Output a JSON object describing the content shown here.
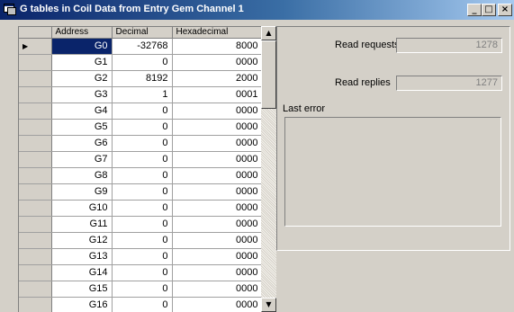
{
  "window": {
    "title": "G tables in Coil Data from Entry Gem Channel 1",
    "minimize": "_",
    "maximize": "□",
    "close": "×"
  },
  "grid": {
    "columns": [
      "Address",
      "Decimal",
      "Hexadecimal"
    ],
    "current_row_marker": "▶",
    "rows": [
      {
        "address": "G0",
        "decimal": "-32768",
        "hex": "8000"
      },
      {
        "address": "G1",
        "decimal": "0",
        "hex": "0000"
      },
      {
        "address": "G2",
        "decimal": "8192",
        "hex": "2000"
      },
      {
        "address": "G3",
        "decimal": "1",
        "hex": "0001"
      },
      {
        "address": "G4",
        "decimal": "0",
        "hex": "0000"
      },
      {
        "address": "G5",
        "decimal": "0",
        "hex": "0000"
      },
      {
        "address": "G6",
        "decimal": "0",
        "hex": "0000"
      },
      {
        "address": "G7",
        "decimal": "0",
        "hex": "0000"
      },
      {
        "address": "G8",
        "decimal": "0",
        "hex": "0000"
      },
      {
        "address": "G9",
        "decimal": "0",
        "hex": "0000"
      },
      {
        "address": "G10",
        "decimal": "0",
        "hex": "0000"
      },
      {
        "address": "G11",
        "decimal": "0",
        "hex": "0000"
      },
      {
        "address": "G12",
        "decimal": "0",
        "hex": "0000"
      },
      {
        "address": "G13",
        "decimal": "0",
        "hex": "0000"
      },
      {
        "address": "G14",
        "decimal": "0",
        "hex": "0000"
      },
      {
        "address": "G15",
        "decimal": "0",
        "hex": "0000"
      },
      {
        "address": "G16",
        "decimal": "0",
        "hex": "0000"
      }
    ]
  },
  "scrollbar": {
    "up": "▲",
    "down": "▼"
  },
  "stats": {
    "read_requests_label": "Read requests",
    "read_requests_value": "1278",
    "read_replies_label": "Read replies",
    "read_replies_value": "1277",
    "last_error_label": "Last error",
    "last_error_value": ""
  }
}
